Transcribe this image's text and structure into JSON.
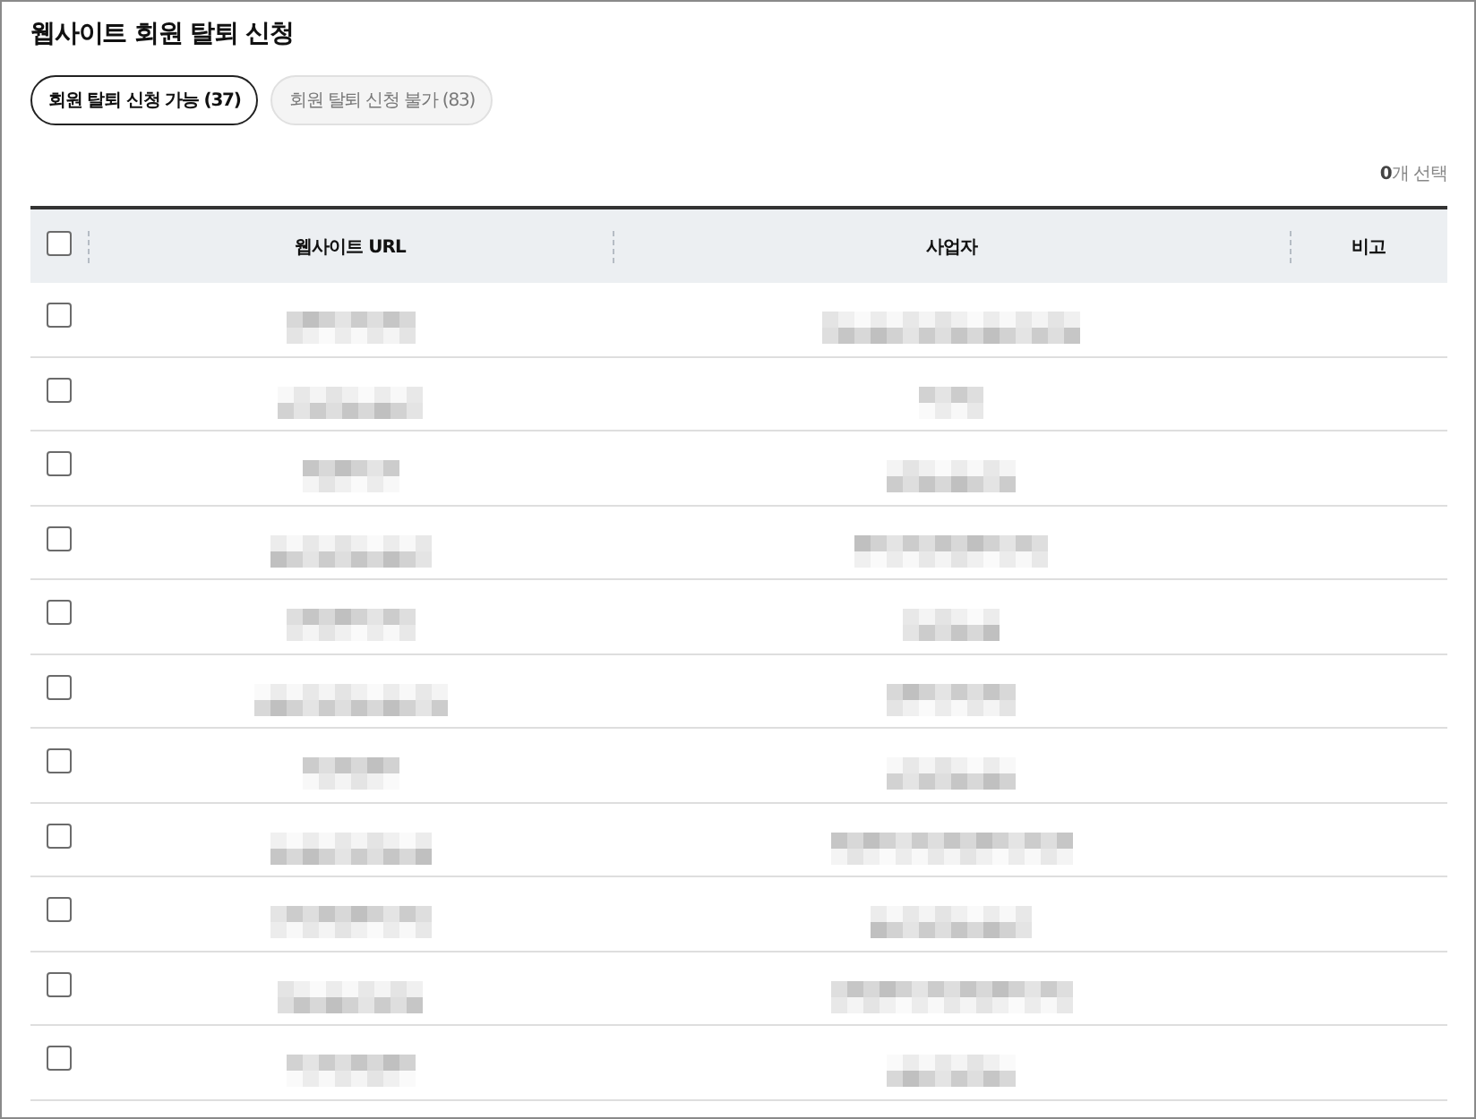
{
  "page": {
    "title": "웹사이트 회원 탈퇴 신청"
  },
  "tabs": [
    {
      "label": "회원 탈퇴 신청 가능 (37)",
      "selected": true
    },
    {
      "label": "회원 탈퇴 신청 불가 (83)",
      "selected": false
    }
  ],
  "selection_count": "**0**개 선택",
  "table": {
    "select_all": {
      "checked": false
    },
    "columns": [
      "웹사이트 URL",
      "사업자",
      "비고"
    ],
    "rows": [
      {
        "checked": false
      },
      {
        "checked": false
      },
      {
        "checked": false
      },
      {
        "checked": false
      },
      {
        "checked": false
      },
      {
        "checked": false
      },
      {
        "checked": false
      },
      {
        "checked": false
      },
      {
        "checked": false
      },
      {
        "checked": false
      },
      {
        "checked": false
      }
    ]
  }
}
